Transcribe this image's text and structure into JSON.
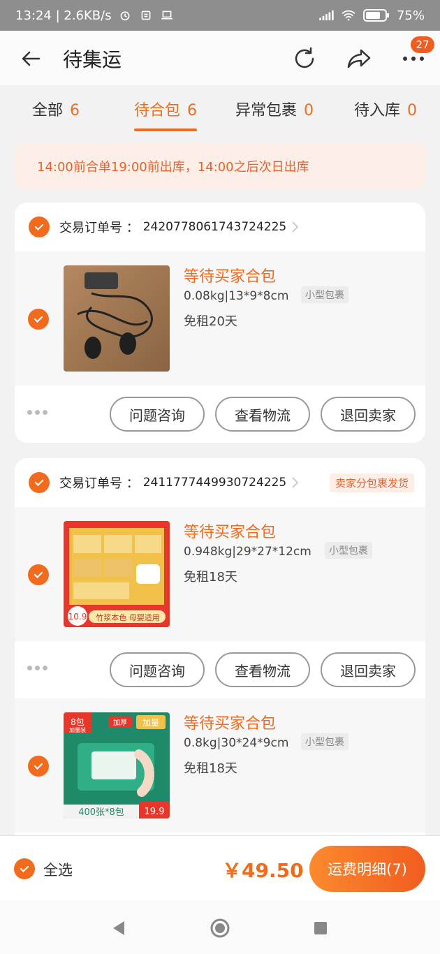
{
  "status_bar": {
    "time_speed": "13:24 | 2.6KB/s",
    "battery": "75%"
  },
  "header": {
    "title": "待集运",
    "badge": "27"
  },
  "tabs": [
    {
      "label": "全部",
      "count": "6"
    },
    {
      "label": "待合包",
      "count": "6"
    },
    {
      "label": "异常包裹",
      "count": "0"
    },
    {
      "label": "待入库",
      "count": "0"
    }
  ],
  "notice": "14:00前合单19:00前出库，14:00之后次日出库",
  "order_label": "交易订单号 ：",
  "orders": [
    {
      "order_no": "2420778061743724225",
      "seller_tag": "",
      "items": [
        {
          "status": "等待买家合包",
          "spec": "0.08kg|13*9*8cm",
          "size_tag": "小型包裹",
          "rent": "免租20天"
        }
      ]
    },
    {
      "order_no": "2411777449930724225",
      "seller_tag": "卖家分包裹发货",
      "items": [
        {
          "status": "等待买家合包",
          "spec": "0.948kg|29*27*12cm",
          "size_tag": "小型包裹",
          "rent": "免租18天"
        },
        {
          "status": "等待买家合包",
          "spec": "0.8kg|30*24*9cm",
          "size_tag": "小型包裹",
          "rent": "免租18天"
        }
      ]
    }
  ],
  "thumbs": {
    "tissue_a": {
      "price": "10.9",
      "caption": "竹浆本色 母婴适用"
    },
    "tissue_b": {
      "pack_count": "8包",
      "pack_label": "加量装",
      "thick_label": "加厚",
      "more_label": "加量",
      "bottom_text": "400张*8包",
      "price": "19.9"
    }
  },
  "actions": {
    "consult": "问题咨询",
    "logistics": "查看物流",
    "return": "退回卖家"
  },
  "bottom": {
    "select_all": "全选",
    "total": "￥49.50",
    "fee_button": "运费明细(7)"
  },
  "colors": {
    "accent": "#f26b1d",
    "notice_bg": "#fdeee7"
  }
}
